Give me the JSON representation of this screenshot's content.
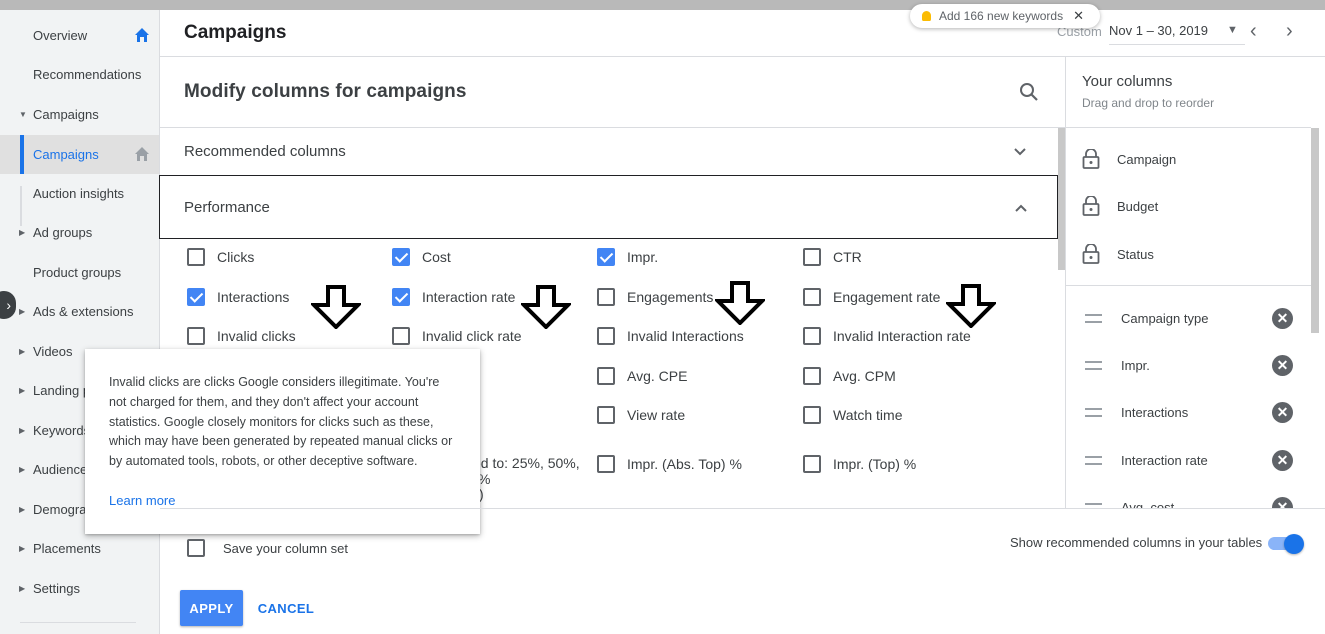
{
  "sidebar": {
    "items": [
      {
        "label": "Overview"
      },
      {
        "label": "Recommendations"
      },
      {
        "label": "Campaigns"
      },
      {
        "label": "Campaigns"
      },
      {
        "label": "Auction insights"
      },
      {
        "label": "Ad groups"
      },
      {
        "label": "Product groups"
      },
      {
        "label": "Ads & extensions"
      },
      {
        "label": "Videos"
      },
      {
        "label": "Landing p"
      },
      {
        "label": "Keywords"
      },
      {
        "label": "Audience"
      },
      {
        "label": "Demogra"
      },
      {
        "label": "Placements"
      },
      {
        "label": "Settings"
      }
    ]
  },
  "header": {
    "title": "Campaigns",
    "custom_label": "Custom",
    "date_range": "Nov 1 – 30, 2019",
    "toast": "Add 166 new keywords"
  },
  "panel": {
    "title": "Modify columns for campaigns",
    "recommended": "Recommended columns",
    "performance": "Performance"
  },
  "columns": [
    {
      "label": "Clicks",
      "checked": false
    },
    {
      "label": "Cost",
      "checked": true
    },
    {
      "label": "Impr.",
      "checked": true
    },
    {
      "label": "CTR",
      "checked": false
    },
    {
      "label": "Interactions",
      "checked": true
    },
    {
      "label": "Interaction rate",
      "checked": true
    },
    {
      "label": "Engagements",
      "checked": false
    },
    {
      "label": "Engagement rate",
      "checked": false
    },
    {
      "label": "Invalid clicks",
      "checked": false
    },
    {
      "label": "Invalid click rate",
      "checked": false
    },
    {
      "label": "Invalid Interactions",
      "checked": false
    },
    {
      "label": "Invalid Interaction rate",
      "checked": false
    },
    {
      "label": "Avg. CPE",
      "checked": false
    },
    {
      "label": "Avg. CPM",
      "checked": false
    },
    {
      "label": "View rate",
      "checked": false
    },
    {
      "label": "Watch time",
      "checked": false
    },
    {
      "label": "Impr. (Abs. Top) %",
      "checked": false
    },
    {
      "label": "Impr. (Top) %",
      "checked": false
    }
  ],
  "partial_text": {
    "line1": "yed to: 25%, 50%,",
    "line2": "%",
    "line3": ")"
  },
  "tooltip": {
    "text": "Invalid clicks are clicks Google considers illegitimate. You're not charged for them, and they don't affect your account statistics. Google closely monitors for clicks such as these, which may have been generated by repeated manual clicks or by automated tools, robots, or other deceptive software.",
    "link": "Learn more"
  },
  "your_columns": {
    "title": "Your columns",
    "hint": "Drag and drop to reorder",
    "locked": [
      "Campaign",
      "Budget",
      "Status"
    ],
    "movable": [
      "Campaign type",
      "Impr.",
      "Interactions",
      "Interaction rate",
      "Avg. cost"
    ]
  },
  "footer": {
    "save_set": "Save your column set",
    "show_recommended": "Show recommended columns in your tables",
    "apply": "APPLY",
    "cancel": "CANCEL"
  },
  "colors": {
    "accent": "#1a73e8",
    "checkbox_on": "#4285f4",
    "sidebar_bg": "#f1f3f4"
  }
}
